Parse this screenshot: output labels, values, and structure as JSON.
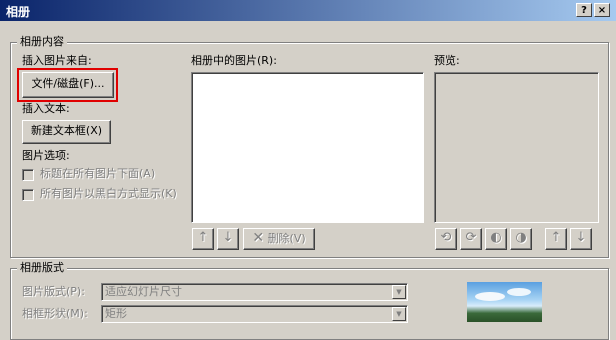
{
  "window": {
    "title": "相册",
    "help_label": "?",
    "close_label": "×"
  },
  "content_group": {
    "legend": "相册内容",
    "insert_from_label": "插入图片来自:",
    "file_button": "文件/磁盘(F)...",
    "insert_text_label": "插入文本:",
    "new_textbox_button": "新建文本框(X)",
    "picture_options_label": "图片选项:",
    "option1": "标题在所有图片下面(A)",
    "option2": "所有图片以黑白方式显示(K)",
    "pictures_label": "相册中的图片(R):",
    "preview_label": "预览:",
    "delete_button": "删除(V)"
  },
  "layout_group": {
    "legend": "相册版式",
    "picture_layout_label": "图片版式(P):",
    "picture_layout_value": "适应幻灯片尺寸",
    "frame_shape_label": "相框形状(M):",
    "frame_shape_value": "矩形"
  }
}
